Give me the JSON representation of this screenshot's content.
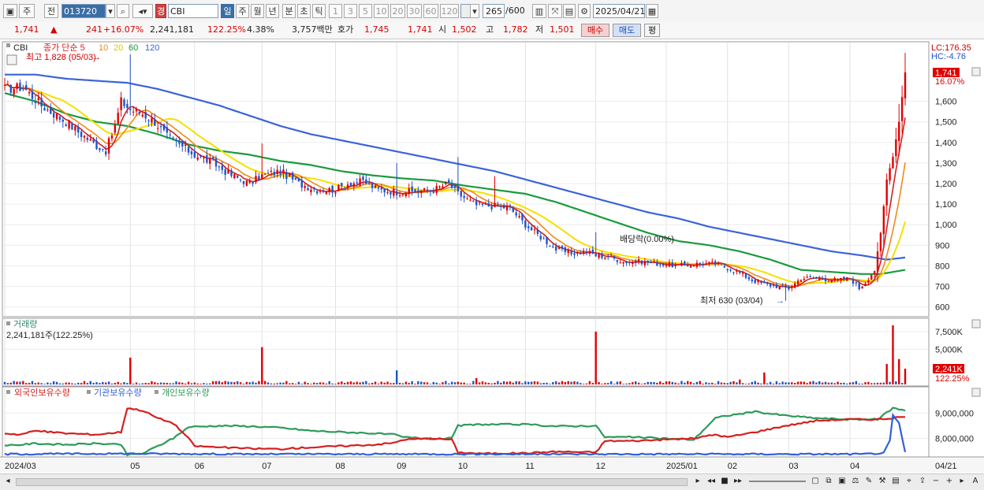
{
  "toolbar": {
    "market": "주",
    "prev": "전",
    "code": "013720",
    "name_badge": "경",
    "name": "CBI",
    "periods": [
      "일",
      "주",
      "월",
      "년",
      "분",
      "초",
      "틱"
    ],
    "active_period": "일",
    "intervals": [
      "1",
      "3",
      "5",
      "10",
      "20",
      "30",
      "60",
      "120"
    ],
    "count": "265",
    "count_total": "/600",
    "date": "2025/04/21"
  },
  "quote": {
    "price": "1,741",
    "arrow": "▲",
    "change": "241",
    "change_pct": "+16.07%",
    "volume": "2,241,181",
    "volume_ratio": "122.25%",
    "turnover": "4.38%",
    "amount": "3,757백만",
    "bid_label": "호가",
    "ask": "1,745",
    "bid": "1,741",
    "open_label": "시",
    "open": "1,502",
    "high_label": "고",
    "high": "1,782",
    "low_label": "저",
    "low": "1,501",
    "buy_button": "매수",
    "sell_button": "매도",
    "eval_button": "평"
  },
  "chart_data": {
    "type": "candlestick",
    "colors": {
      "up": "#e00000",
      "down": "#1f54c8",
      "ma5": "#d22020",
      "ma10": "#f08a18",
      "ma20": "#f5e000",
      "ma60": "#1a9b3c",
      "ma120": "#3b62d8",
      "foreign": "#d42020",
      "institution": "#3060d8",
      "individual": "#2e9a5c"
    },
    "price_panel": {
      "legend_name": "CBI",
      "legend_ma": [
        "종가 단순 5",
        "10",
        "20",
        "60",
        "120"
      ],
      "ylim": [
        560,
        1840
      ],
      "ticks": [
        600,
        700,
        800,
        900,
        1000,
        1100,
        1200,
        1300,
        1400,
        1500,
        1600
      ],
      "tick_labels": [
        "600",
        "700",
        "800",
        "900",
        "1,000",
        "1,100",
        "1,200",
        "1,300",
        "1,400",
        "1,500",
        "1,600"
      ],
      "lc_label": "LC:176.35",
      "hc_label": "HC:-4.76",
      "last_price_label": "1,741",
      "last_pct_label": "16.07%",
      "annotation_high": "최고 1,828 (05/03)",
      "annotation_low": "최저 630 (03/04)",
      "annotation_dividend": "배당락(0.00%)"
    },
    "x_axis": {
      "tick_labels": [
        "2024/03",
        "05",
        "06",
        "07",
        "08",
        "09",
        "10",
        "11",
        "12",
        "2025/01",
        "02",
        "03",
        "04",
        "04/21"
      ],
      "tick_index": [
        0,
        41,
        62,
        84,
        108,
        128,
        148,
        170,
        193,
        216,
        236,
        256,
        276,
        296
      ]
    },
    "close_anchors": [
      [
        0,
        1660
      ],
      [
        6,
        1670
      ],
      [
        12,
        1580
      ],
      [
        20,
        1500
      ],
      [
        25,
        1440
      ],
      [
        30,
        1385
      ],
      [
        33,
        1360
      ],
      [
        36,
        1480
      ],
      [
        38,
        1600
      ],
      [
        41,
        1560
      ],
      [
        45,
        1540
      ],
      [
        49,
        1500
      ],
      [
        53,
        1430
      ],
      [
        58,
        1380
      ],
      [
        62,
        1340
      ],
      [
        68,
        1300
      ],
      [
        74,
        1240
      ],
      [
        80,
        1200
      ],
      [
        84,
        1240
      ],
      [
        90,
        1260
      ],
      [
        96,
        1200
      ],
      [
        102,
        1170
      ],
      [
        108,
        1170
      ],
      [
        112,
        1200
      ],
      [
        117,
        1210
      ],
      [
        122,
        1170
      ],
      [
        128,
        1160
      ],
      [
        134,
        1160
      ],
      [
        140,
        1170
      ],
      [
        145,
        1200
      ],
      [
        148,
        1150
      ],
      [
        154,
        1095
      ],
      [
        160,
        1090
      ],
      [
        165,
        1080
      ],
      [
        170,
        1000
      ],
      [
        175,
        940
      ],
      [
        180,
        880
      ],
      [
        185,
        860
      ],
      [
        190,
        870
      ],
      [
        193,
        850
      ],
      [
        197,
        845
      ],
      [
        202,
        820
      ],
      [
        208,
        820
      ],
      [
        214,
        810
      ],
      [
        220,
        800
      ],
      [
        226,
        810
      ],
      [
        232,
        810
      ],
      [
        236,
        790
      ],
      [
        240,
        765
      ],
      [
        244,
        730
      ],
      [
        248,
        710
      ],
      [
        252,
        700
      ],
      [
        256,
        690
      ],
      [
        260,
        740
      ],
      [
        264,
        740
      ],
      [
        268,
        735
      ],
      [
        272,
        730
      ],
      [
        276,
        740
      ],
      [
        279,
        690
      ],
      [
        281,
        720
      ],
      [
        284,
        780
      ],
      [
        286,
        960
      ],
      [
        288,
        1220
      ],
      [
        290,
        1330
      ],
      [
        292,
        1500
      ],
      [
        294,
        1741
      ]
    ],
    "ma_anchors": {
      "ma60": [
        [
          0,
          1640
        ],
        [
          10,
          1600
        ],
        [
          20,
          1540
        ],
        [
          30,
          1500
        ],
        [
          40,
          1480
        ],
        [
          50,
          1440
        ],
        [
          60,
          1390
        ],
        [
          70,
          1360
        ],
        [
          80,
          1340
        ],
        [
          90,
          1310
        ],
        [
          100,
          1290
        ],
        [
          110,
          1260
        ],
        [
          120,
          1240
        ],
        [
          130,
          1225
        ],
        [
          140,
          1215
        ],
        [
          150,
          1190
        ],
        [
          160,
          1170
        ],
        [
          170,
          1150
        ],
        [
          180,
          1110
        ],
        [
          190,
          1060
        ],
        [
          200,
          1010
        ],
        [
          210,
          960
        ],
        [
          220,
          920
        ],
        [
          230,
          900
        ],
        [
          240,
          870
        ],
        [
          250,
          830
        ],
        [
          260,
          780
        ],
        [
          270,
          770
        ],
        [
          280,
          760
        ],
        [
          286,
          760
        ],
        [
          290,
          770
        ],
        [
          294,
          780
        ]
      ],
      "ma120": [
        [
          0,
          1730
        ],
        [
          10,
          1730
        ],
        [
          20,
          1710
        ],
        [
          30,
          1700
        ],
        [
          40,
          1690
        ],
        [
          50,
          1660
        ],
        [
          60,
          1620
        ],
        [
          70,
          1580
        ],
        [
          80,
          1530
        ],
        [
          90,
          1480
        ],
        [
          100,
          1440
        ],
        [
          110,
          1410
        ],
        [
          120,
          1380
        ],
        [
          130,
          1350
        ],
        [
          140,
          1320
        ],
        [
          150,
          1290
        ],
        [
          160,
          1260
        ],
        [
          170,
          1220
        ],
        [
          180,
          1180
        ],
        [
          190,
          1140
        ],
        [
          200,
          1100
        ],
        [
          210,
          1060
        ],
        [
          220,
          1030
        ],
        [
          230,
          990
        ],
        [
          240,
          960
        ],
        [
          250,
          930
        ],
        [
          260,
          900
        ],
        [
          270,
          870
        ],
        [
          280,
          850
        ],
        [
          288,
          830
        ],
        [
          294,
          840
        ]
      ]
    },
    "volume_panel": {
      "title": "거래량",
      "value_label": "2,241,181주(122.25%)",
      "ylim": [
        0,
        8500
      ],
      "ticks": [
        5000,
        7500
      ],
      "tick_labels": [
        "5,000K",
        "7,500K"
      ],
      "last_label": "2,241K",
      "last_pct": "122.25%",
      "spikes": [
        [
          41,
          3800,
          "up"
        ],
        [
          84,
          5300,
          "up"
        ],
        [
          128,
          2000,
          "down"
        ],
        [
          154,
          900,
          "up"
        ],
        [
          193,
          7500,
          "up"
        ],
        [
          240,
          700,
          "up"
        ],
        [
          248,
          1700,
          "up"
        ],
        [
          288,
          2900,
          "up"
        ],
        [
          290,
          8400,
          "up"
        ],
        [
          292,
          3600,
          "up"
        ],
        [
          294,
          2241,
          "up"
        ]
      ]
    },
    "holder_panel": {
      "legend": [
        "외국인보유수량",
        "기관보유수량",
        "개인보유수량"
      ],
      "ylim": [
        7300000,
        9600000
      ],
      "ticks": [
        8000000,
        9000000
      ],
      "tick_labels": [
        "8,000,000",
        "9,000,000"
      ],
      "foreign": [
        [
          0,
          8200000
        ],
        [
          5,
          8150000
        ],
        [
          10,
          8300000
        ],
        [
          20,
          8200000
        ],
        [
          30,
          8150000
        ],
        [
          38,
          8250000
        ],
        [
          40,
          9200000
        ],
        [
          45,
          9100000
        ],
        [
          50,
          8800000
        ],
        [
          55,
          8600000
        ],
        [
          58,
          8250000
        ],
        [
          60,
          8000000
        ],
        [
          62,
          7700000
        ],
        [
          70,
          7650000
        ],
        [
          80,
          7600000
        ],
        [
          90,
          7580000
        ],
        [
          100,
          7650000
        ],
        [
          110,
          7700000
        ],
        [
          120,
          7750000
        ],
        [
          127,
          7820000
        ],
        [
          130,
          7950000
        ],
        [
          140,
          8000000
        ],
        [
          146,
          7950000
        ],
        [
          148,
          7450000
        ],
        [
          155,
          7400000
        ],
        [
          170,
          7420000
        ],
        [
          180,
          7480000
        ],
        [
          193,
          7450000
        ],
        [
          196,
          7900000
        ],
        [
          205,
          7900000
        ],
        [
          215,
          7950000
        ],
        [
          225,
          8000000
        ],
        [
          232,
          8150000
        ],
        [
          236,
          8050000
        ],
        [
          245,
          8250000
        ],
        [
          255,
          8500000
        ],
        [
          265,
          8700000
        ],
        [
          275,
          8750000
        ],
        [
          285,
          8750000
        ],
        [
          290,
          8800000
        ],
        [
          294,
          8850000
        ]
      ],
      "institution": [
        [
          0,
          7380000
        ],
        [
          40,
          7400000
        ],
        [
          80,
          7380000
        ],
        [
          120,
          7380000
        ],
        [
          160,
          7380000
        ],
        [
          200,
          7380000
        ],
        [
          240,
          7380000
        ],
        [
          280,
          7380000
        ],
        [
          287,
          7420000
        ],
        [
          289,
          7900000
        ],
        [
          290,
          8900000
        ],
        [
          292,
          8600000
        ],
        [
          294,
          7450000
        ]
      ],
      "individual": [
        [
          0,
          7700000
        ],
        [
          10,
          7800000
        ],
        [
          20,
          7750000
        ],
        [
          30,
          7800000
        ],
        [
          38,
          7750000
        ],
        [
          40,
          7350000
        ],
        [
          45,
          7400000
        ],
        [
          50,
          7700000
        ],
        [
          55,
          8000000
        ],
        [
          60,
          8450000
        ],
        [
          70,
          8500000
        ],
        [
          80,
          8480000
        ],
        [
          90,
          8420000
        ],
        [
          100,
          8300000
        ],
        [
          110,
          8250000
        ],
        [
          120,
          8200000
        ],
        [
          127,
          8150000
        ],
        [
          130,
          8050000
        ],
        [
          140,
          7980000
        ],
        [
          146,
          8000000
        ],
        [
          148,
          8500000
        ],
        [
          155,
          8550000
        ],
        [
          170,
          8550000
        ],
        [
          180,
          8480000
        ],
        [
          193,
          8500000
        ],
        [
          196,
          8050000
        ],
        [
          205,
          8050000
        ],
        [
          215,
          8000000
        ],
        [
          225,
          7950000
        ],
        [
          232,
          8800000
        ],
        [
          236,
          8900000
        ],
        [
          245,
          9050000
        ],
        [
          255,
          8900000
        ],
        [
          265,
          8800000
        ],
        [
          275,
          8750000
        ],
        [
          285,
          8750000
        ],
        [
          290,
          9200000
        ],
        [
          294,
          9100000
        ]
      ]
    }
  }
}
